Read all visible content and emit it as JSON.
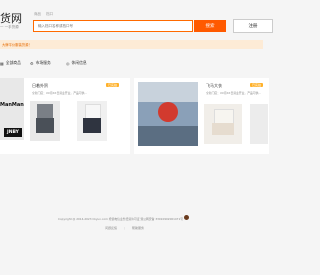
{
  "header": {
    "logo_text": "货网",
    "logo_sub": "一 一手货源",
    "tabs": [
      "商品",
      "档口"
    ],
    "search_placeholder": "输入档口名称或档口号",
    "search_label": "搜索",
    "register_label": "注册"
  },
  "notice": {
    "text": "大牌平价服装货源！"
  },
  "categories": [
    {
      "icon": "grid-icon",
      "label": "全部商品"
    },
    {
      "icon": "gear-icon",
      "label": "市场服务"
    },
    {
      "icon": "globe-icon",
      "label": "休闲信息"
    }
  ],
  "stores": [
    {
      "name": "日着外贸",
      "tag": "已实拍",
      "desc": "全新门店：XX月XX日营业开业，产品可供...",
      "brand_texts": [
        "JNBY"
      ],
      "banner_text": "ManMan"
    },
    {
      "name": "飞马大衣",
      "tag": "已实拍",
      "desc": "全新门店：XX月XX日营业开业，产品可供...",
      "brand_texts": [],
      "banner_text": ""
    }
  ],
  "footer": {
    "line1": "Copyright @ 2014-2023 Ckyun.com     增值电信业务经营许可证     浙公网安备 33010902001471号",
    "links": [
      "问题反馈",
      "帮助服务"
    ]
  }
}
